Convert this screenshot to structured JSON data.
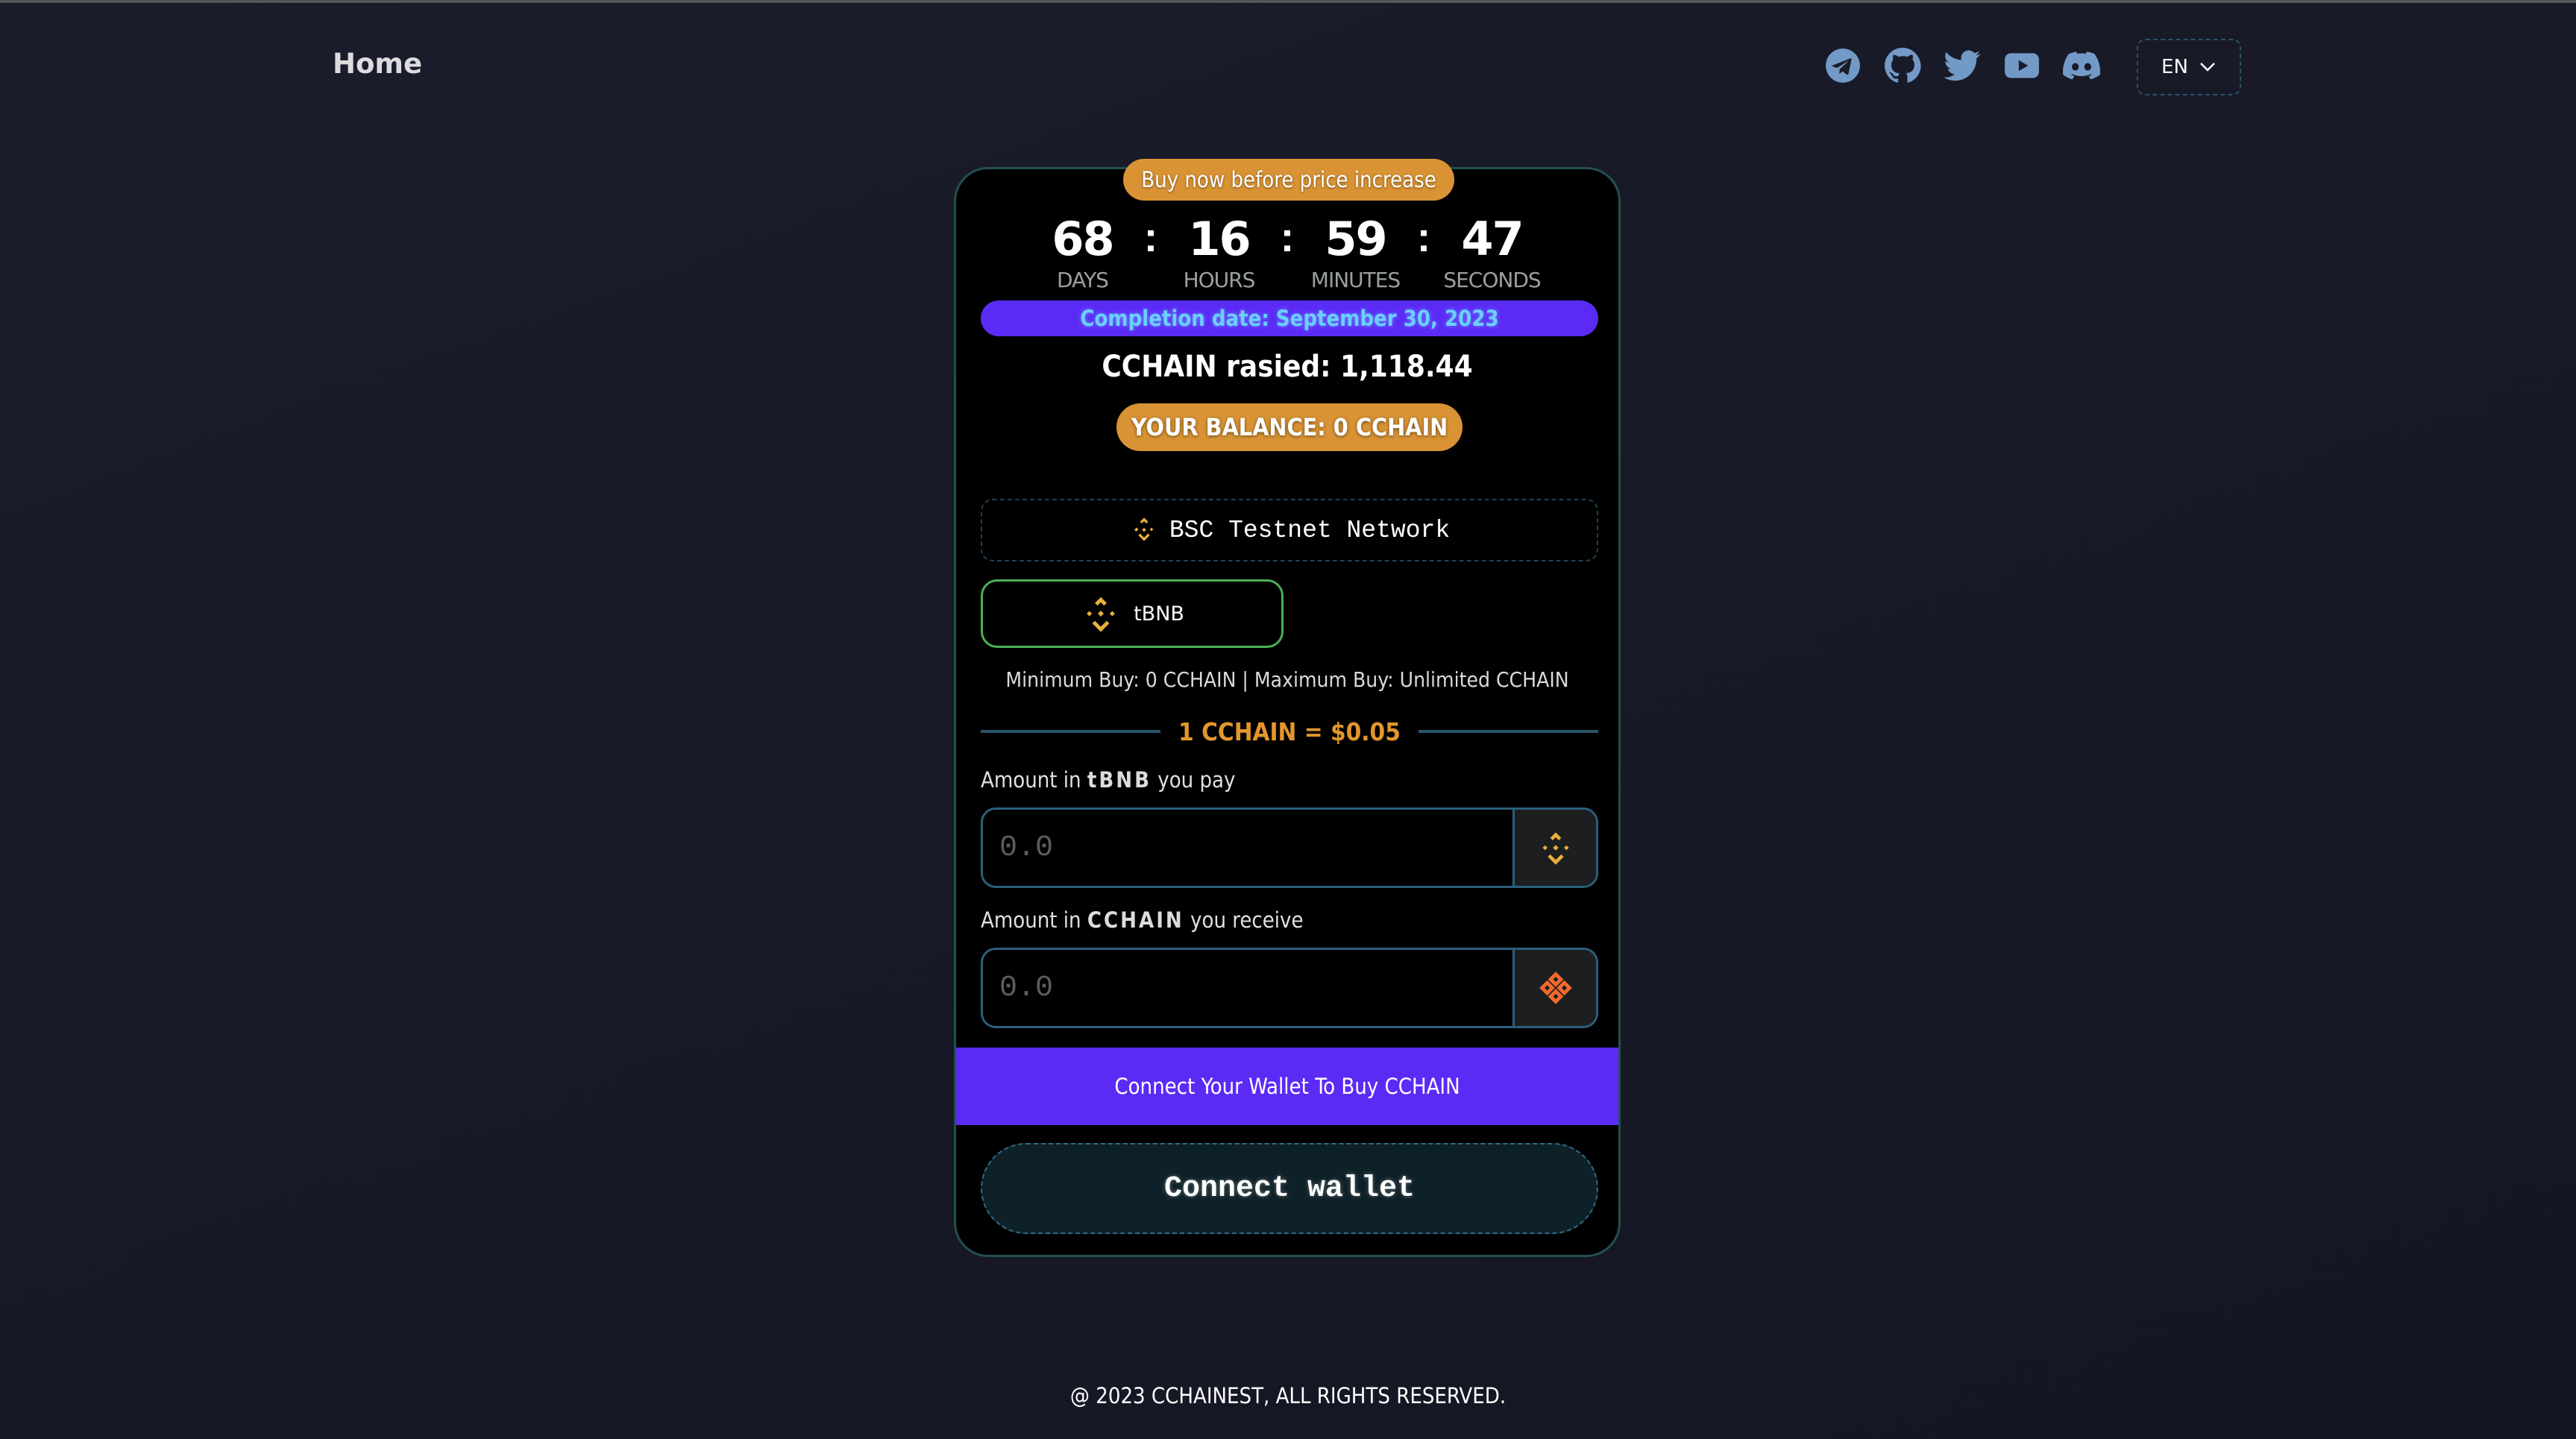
{
  "header": {
    "home_label": "Home",
    "socials": [
      {
        "name": "telegram",
        "icon": "telegram-icon"
      },
      {
        "name": "github",
        "icon": "github-icon"
      },
      {
        "name": "twitter",
        "icon": "twitter-icon"
      },
      {
        "name": "youtube",
        "icon": "youtube-icon"
      },
      {
        "name": "discord",
        "icon": "discord-icon"
      }
    ],
    "language": "EN"
  },
  "card": {
    "promo_badge": "Buy now before price increase",
    "countdown": {
      "days": "68",
      "days_label": "DAYS",
      "hours": "16",
      "hours_label": "HOURS",
      "minutes": "59",
      "minutes_label": "MINUTES",
      "seconds": "47",
      "seconds_label": "SECONDS",
      "separator": ":"
    },
    "completion_date": "Completion date: September 30, 2023",
    "raised": "CCHAIN rasied: 1,118.44",
    "balance": "YOUR BALANCE: 0 CCHAIN",
    "network": {
      "label": "BSC Testnet Network",
      "icon": "bnb-icon"
    },
    "token_button": {
      "label": "tBNB",
      "icon": "bnb-icon"
    },
    "limits": "Minimum Buy: 0 CCHAIN | Maximum Buy: Unlimited CCHAIN",
    "price": "1 CCHAIN = $0.05",
    "pay_field": {
      "label_prefix": "Amount in",
      "label_token": "tBNB",
      "label_suffix": "you pay",
      "value": "",
      "placeholder": "0.0",
      "icon": "bnb-icon"
    },
    "receive_field": {
      "label_prefix": "Amount in",
      "label_token": "CCHAIN",
      "label_suffix": "you receive",
      "value": "",
      "placeholder": "0.0",
      "icon": "cchain-logo-icon"
    },
    "cta_band": "Connect Your Wallet To Buy CCHAIN",
    "connect_button": "Connect wallet"
  },
  "footer": {
    "copyright": "@ 2023 CCHAINEST, ALL RIGHTS RESERVED."
  },
  "colors": {
    "background": "#191b29",
    "card_bg": "#000000",
    "card_border": "#23504f",
    "accent_orange": "#d99334",
    "accent_purple": "#5b2bf5",
    "completion_text": "#6ad0ff",
    "social_icon": "#7399c6",
    "bnb_yellow": "#f0b90b",
    "cchain_orange": "#f26a2e",
    "token_border_green": "#4caf58"
  }
}
